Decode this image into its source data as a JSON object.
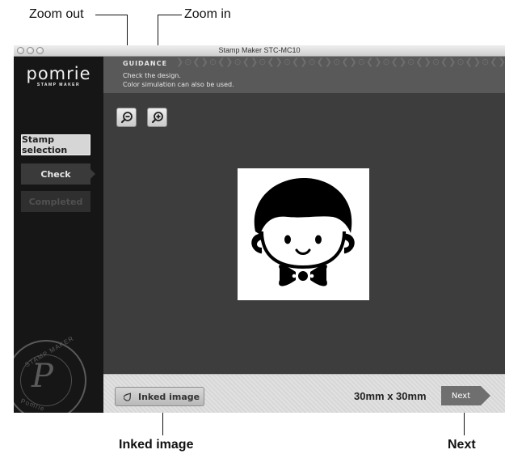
{
  "callouts": {
    "zoom_out": "Zoom out",
    "zoom_in": "Zoom in",
    "inked_image": "Inked image",
    "next": "Next"
  },
  "window": {
    "title": "Stamp Maker STC-MC10"
  },
  "sidebar": {
    "logo": {
      "main": "pomrie",
      "sub": "STAMP MAKER"
    },
    "steps": [
      {
        "label": "Stamp selection",
        "state": "done"
      },
      {
        "label": "Check",
        "state": "current"
      },
      {
        "label": "Completed",
        "state": "pending"
      }
    ],
    "seal": {
      "letter": "P",
      "top_text": "STAMP MAKER",
      "bottom_text": "Pomrie"
    }
  },
  "guidance": {
    "title": "GUIDANCE",
    "lines": [
      "Check the design.",
      "Color simulation can also be used."
    ]
  },
  "toolbar": {
    "zoom_out_icon": "zoom-out-icon",
    "zoom_in_icon": "zoom-in-icon"
  },
  "preview": {
    "image": "stamp-design-boy-face-with-bow-tie"
  },
  "footer": {
    "inked_button": "Inked image",
    "inked_icon": "drop-icon",
    "size": "30mm x 30mm",
    "next_button": "Next"
  },
  "colors": {
    "sidebar_bg": "#161616",
    "main_bg": "#3d3d3d",
    "guidance_bg": "#595959",
    "next_bg": "#6f6f6f"
  }
}
